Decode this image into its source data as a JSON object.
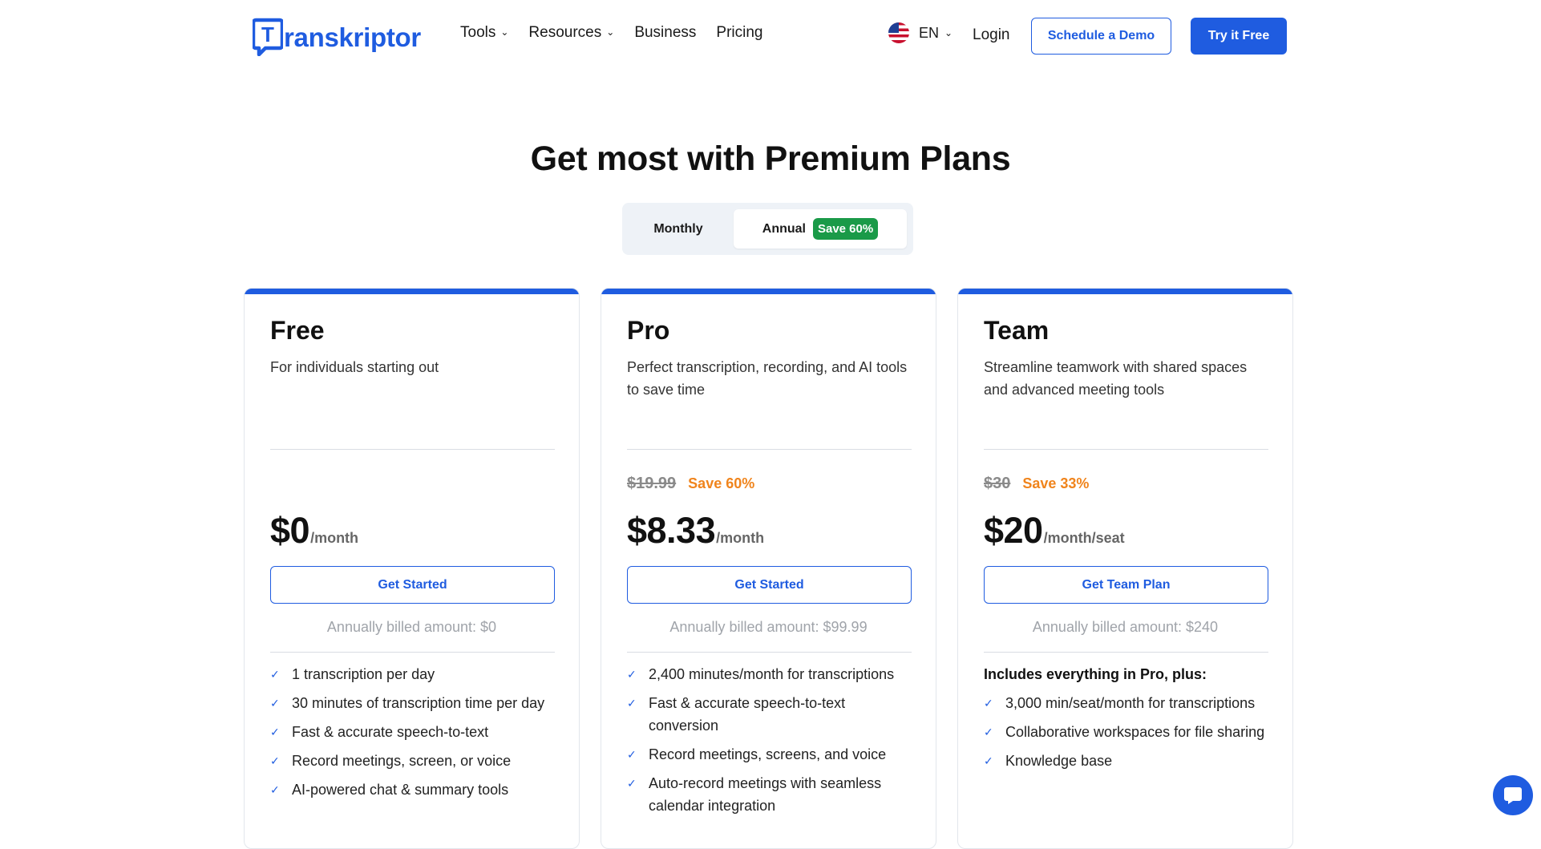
{
  "header": {
    "logo_text": "ranskriptor",
    "logo_letter": "T",
    "nav": [
      {
        "label": "Tools",
        "dropdown": true
      },
      {
        "label": "Resources",
        "dropdown": true
      },
      {
        "label": "Business",
        "dropdown": false
      },
      {
        "label": "Pricing",
        "dropdown": false
      }
    ],
    "language": "EN",
    "login": "Login",
    "schedule_demo": "Schedule a Demo",
    "try_free": "Try it Free"
  },
  "hero": {
    "title": "Get most with Premium Plans",
    "toggle": {
      "monthly": "Monthly",
      "annual": "Annual",
      "annual_badge": "Save 60%",
      "selected": "Annual"
    }
  },
  "plans": [
    {
      "name": "Free",
      "description": "For individuals starting out",
      "old_price": "",
      "save": "",
      "price": "$0",
      "unit": "/month",
      "button": "Get Started",
      "billed": "Annually billed amount: $0",
      "features_heading": "",
      "features": [
        "1 transcription per day",
        "30 minutes of transcription time per day",
        "Fast & accurate speech-to-text",
        "Record meetings, screen, or voice",
        "AI-powered chat & summary tools"
      ]
    },
    {
      "name": "Pro",
      "description": "Perfect transcription, recording, and AI tools to save time",
      "old_price": "$19.99",
      "save": "Save 60%",
      "price": "$8.33",
      "unit": "/month",
      "button": "Get Started",
      "billed": "Annually billed amount: $99.99",
      "features_heading": "",
      "features": [
        "2,400 minutes/month for transcriptions",
        "Fast & accurate speech-to-text conversion",
        "Record meetings, screens, and voice",
        "Auto-record meetings with seamless calendar integration"
      ]
    },
    {
      "name": "Team",
      "description": "Streamline teamwork with shared spaces and advanced meeting tools",
      "old_price": "$30",
      "save": "Save 33%",
      "price": "$20",
      "unit": "/month/seat",
      "button": "Get Team Plan",
      "billed": "Annually billed amount: $240",
      "features_heading": "Includes everything in Pro, plus:",
      "features": [
        "3,000 min/seat/month for transcriptions",
        "Collaborative workspaces for file sharing",
        "Knowledge base"
      ]
    }
  ],
  "colors": {
    "brand": "#1f5ce0",
    "save_green": "#1a9a48",
    "save_orange": "#f0841c"
  },
  "icons": {
    "chat": "chat-bubble-icon",
    "check": "check-icon",
    "chevron": "chevron-down-icon"
  }
}
